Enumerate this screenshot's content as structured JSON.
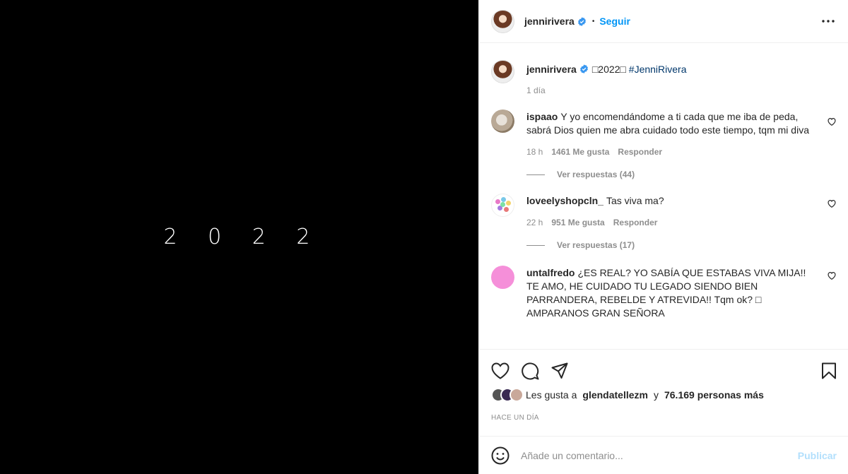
{
  "media": {
    "text": "2 0 2 2"
  },
  "header": {
    "username": "jennirivera",
    "separator": "•",
    "follow_label": "Seguir"
  },
  "caption": {
    "username": "jennirivera",
    "text": "□2022□",
    "hashtag": "#JenniRivera",
    "time": "1 día"
  },
  "comments": [
    {
      "username": "ispaao",
      "text": "Y yo encomendándome a ti cada que me iba de peda, sabrá Dios quien me abra cuidado todo este tiempo, tqm mi diva",
      "time": "18 h",
      "likes": "1461 Me gusta",
      "reply_label": "Responder",
      "replies": "Ver respuestas (44)"
    },
    {
      "username": "loveelyshopcln_",
      "text": "Tas viva ma?",
      "time": "22 h",
      "likes": "951 Me gusta",
      "reply_label": "Responder",
      "replies": "Ver respuestas (17)"
    },
    {
      "username": "untalfredo",
      "text": "¿ES REAL? YO SABÍA QUE ESTABAS VIVA MIJA!! TE AMO, HE CUIDADO TU LEGADO SIENDO BIEN PARRANDERA, REBELDE Y ATREVIDA!! Tqm ok? □ AMPARANOS GRAN SEÑORA"
    }
  ],
  "likes": {
    "prefix": "Les gusta a",
    "user": "glendatellezm",
    "conj": "y",
    "others": "76.169 personas más"
  },
  "posted_ago": "Hace un día",
  "composer": {
    "placeholder": "Añade un comentario...",
    "post_label": "Publicar"
  },
  "colors": {
    "link_blue": "#0095f6",
    "post_disabled": "#b2dffc",
    "hashtag": "#00376b",
    "muted": "#8e8e8e"
  }
}
